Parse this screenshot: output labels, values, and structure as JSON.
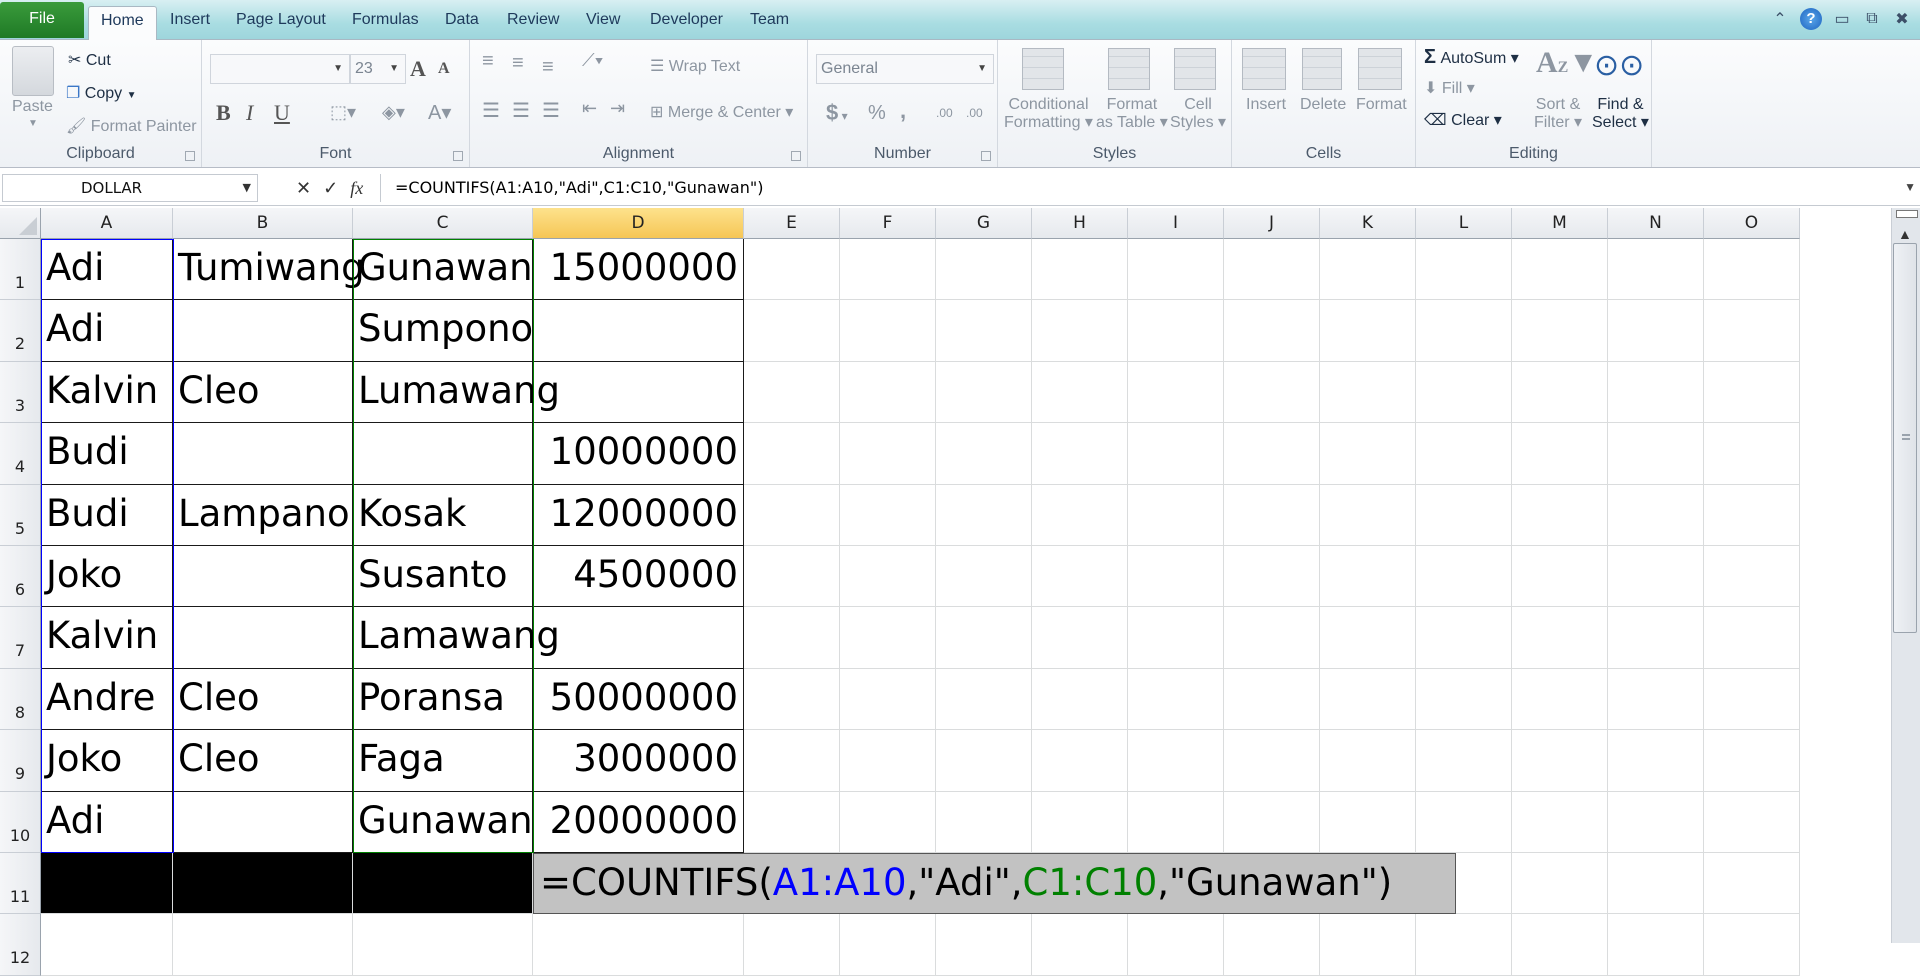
{
  "window": {
    "tabs": [
      "File",
      "Home",
      "Insert",
      "Page Layout",
      "Formulas",
      "Data",
      "Review",
      "View",
      "Developer",
      "Team"
    ],
    "active_tab": "Home",
    "controls": [
      "minimize-ribbon",
      "help",
      "minimize",
      "restore",
      "close"
    ]
  },
  "ribbon": {
    "clipboard": {
      "label": "Clipboard",
      "paste": "Paste",
      "cut": "Cut",
      "copy": "Copy",
      "format_painter": "Format Painter"
    },
    "font": {
      "label": "Font",
      "font_name": "",
      "font_size": "23",
      "bold": "B",
      "italic": "I",
      "underline": "U",
      "grow": "A",
      "shrink": "A",
      "font_color": "A"
    },
    "alignment": {
      "label": "Alignment",
      "wrap_text": "Wrap Text",
      "merge_center": "Merge & Center"
    },
    "number": {
      "label": "Number",
      "format": "General",
      "currency": "$",
      "percent": "%",
      "comma": ",",
      "inc_decimal": ".00",
      "dec_decimal": ".00"
    },
    "styles": {
      "label": "Styles",
      "conditional": [
        "Conditional",
        "Formatting"
      ],
      "format_table": [
        "Format",
        "as Table"
      ],
      "cell_styles": [
        "Cell",
        "Styles"
      ]
    },
    "cells": {
      "label": "Cells",
      "insert": "Insert",
      "delete": "Delete",
      "format": "Format"
    },
    "editing": {
      "label": "Editing",
      "autosum": "AutoSum",
      "fill": "Fill",
      "clear": "Clear",
      "sort_filter": [
        "Sort &",
        "Filter"
      ],
      "find_select": [
        "Find &",
        "Select"
      ]
    }
  },
  "formula_bar": {
    "name_box": "DOLLAR",
    "cancel": "✕",
    "enter": "✓",
    "fx": "fx",
    "formula": "=COUNTIFS(A1:A10,\"Adi\",C1:C10,\"Gunawan\")"
  },
  "sheet": {
    "columns": [
      "A",
      "B",
      "C",
      "D",
      "E",
      "F",
      "G",
      "H",
      "I",
      "J",
      "K",
      "L",
      "M",
      "N",
      "O"
    ],
    "selected_column": "D",
    "rows": [
      {
        "n": "1",
        "A": "Adi",
        "B": "Tumiwang",
        "C": "Gunawan",
        "D": "15000000"
      },
      {
        "n": "2",
        "A": "Adi",
        "B": "",
        "C": "Sumpono",
        "D": ""
      },
      {
        "n": "3",
        "A": "Kalvin",
        "B": "Cleo",
        "C": "Lumawang",
        "D": ""
      },
      {
        "n": "4",
        "A": "Budi",
        "B": "",
        "C": "",
        "D": "10000000"
      },
      {
        "n": "5",
        "A": "Budi",
        "B": "Lampano",
        "C": "Kosak",
        "D": "12000000"
      },
      {
        "n": "6",
        "A": "Joko",
        "B": "",
        "C": "Susanto",
        "D": "4500000"
      },
      {
        "n": "7",
        "A": "Kalvin",
        "B": "",
        "C": "Lamawang",
        "D": ""
      },
      {
        "n": "8",
        "A": "Andre",
        "B": "Cleo",
        "C": "Poransa",
        "D": "50000000"
      },
      {
        "n": "9",
        "A": "Joko",
        "B": "Cleo",
        "C": "Faga",
        "D": "3000000"
      },
      {
        "n": "10",
        "A": "Adi",
        "B": "",
        "C": "Gunawan",
        "D": "20000000"
      },
      {
        "n": "11",
        "A": "",
        "B": "",
        "C": "",
        "D": ""
      },
      {
        "n": "12",
        "A": "",
        "B": "",
        "C": "",
        "D": ""
      }
    ],
    "editing_cell": {
      "ref": "D11",
      "parts": [
        {
          "text": "=COUNTIFS(",
          "color": "#000000"
        },
        {
          "text": "A1:A10",
          "color": "#0000ff"
        },
        {
          "text": ",\"Adi\",",
          "color": "#000000"
        },
        {
          "text": "C1:C10",
          "color": "#008000"
        },
        {
          "text": ",\"Gunawan\")",
          "color": "#000000"
        }
      ]
    },
    "colors": {
      "ref1": "#0000ff",
      "ref2": "#008000",
      "selected_header": "#f6c656",
      "edit_bg": "#c2c2c2"
    }
  }
}
